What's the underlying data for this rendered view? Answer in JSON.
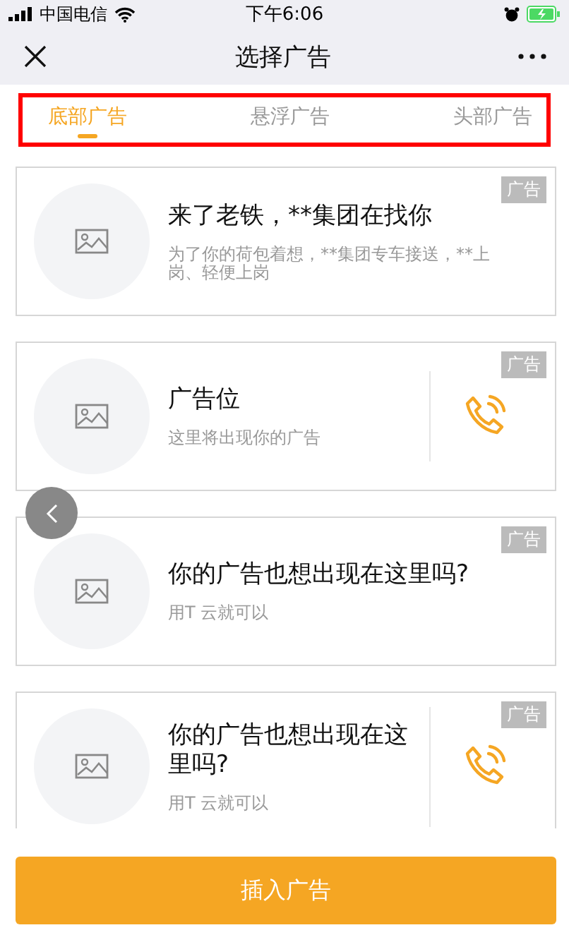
{
  "status_bar": {
    "carrier": "中国电信",
    "time": "下午6:06"
  },
  "nav_bar": {
    "title": "选择广告"
  },
  "tabs": [
    {
      "label": "底部广告",
      "selected": true
    },
    {
      "label": "悬浮广告",
      "selected": false
    },
    {
      "label": "头部广告",
      "selected": false
    }
  ],
  "ads": [
    {
      "kind": "plain",
      "badge": "广告",
      "title": "来了老铁，**集团在找你",
      "subtitle": "为了你的荷包着想，**集团专车接送，**上岗、轻便上岗"
    },
    {
      "kind": "call",
      "badge": "广告",
      "title": "广告位",
      "subtitle": "这里将出现你的广告"
    },
    {
      "kind": "plain",
      "badge": "广告",
      "title": "你的广告也想出现在这里吗?",
      "subtitle": "用T 云就可以"
    },
    {
      "kind": "call",
      "badge": "广告",
      "title": "你的广告也想出现在这里吗?",
      "subtitle": "用T 云就可以"
    }
  ],
  "insert_button": {
    "label": "插入广告"
  }
}
